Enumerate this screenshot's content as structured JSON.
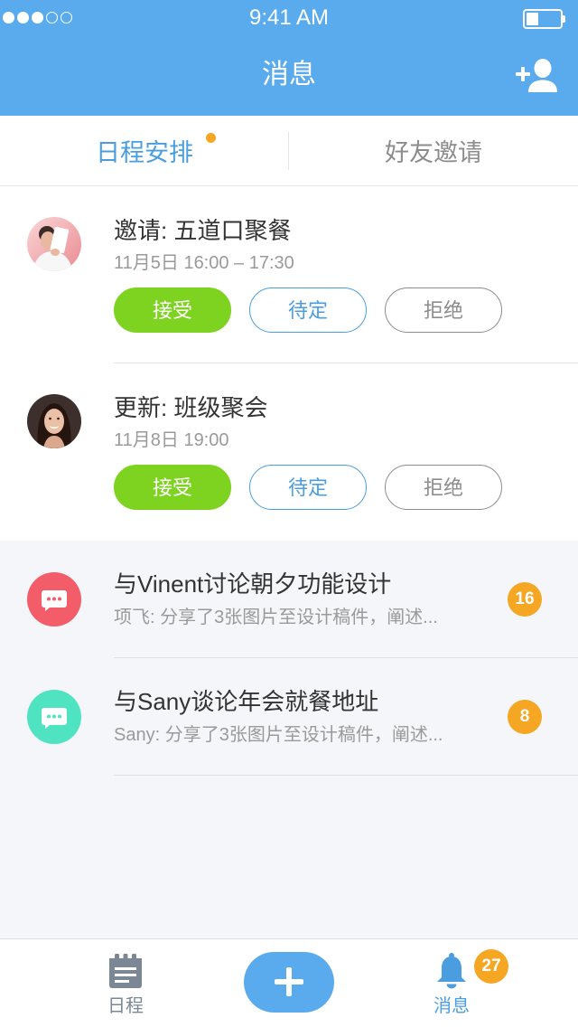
{
  "status_bar": {
    "signal_strength": 3,
    "signal_max": 5,
    "time": "9:41 AM",
    "battery_level": 0.35
  },
  "nav_bar": {
    "title": "消息",
    "action_icon": "add-user-icon"
  },
  "tabs": [
    {
      "label": "日程安排",
      "active": true,
      "unread_dot": true
    },
    {
      "label": "好友邀请",
      "active": false,
      "unread_dot": false
    }
  ],
  "invitation_actions": {
    "accept": "接受",
    "pending": "待定",
    "decline": "拒绝"
  },
  "invitations": [
    {
      "title": "邀请: 五道口聚餐",
      "time": "11月5日 16:00 – 17:30"
    },
    {
      "title": "更新: 班级聚会",
      "time": "11月8日 19:00"
    }
  ],
  "conversations": [
    {
      "title": "与Vinent讨论朝夕功能设计",
      "preview": "项飞: 分享了3张图片至设计稿件，阐述...",
      "unread": "16",
      "icon": "chat-bubble-icon",
      "icon_color": "#f35d69"
    },
    {
      "title": "与Sany谈论年会就餐地址",
      "preview": "Sany: 分享了3张图片至设计稿件，阐述...",
      "unread": "8",
      "icon": "chat-bubble-icon",
      "icon_color": "#50e3c2"
    }
  ],
  "tab_bar": {
    "schedule": {
      "label": "日程",
      "icon": "calendar-icon",
      "active": false
    },
    "compose": {
      "icon": "plus-icon"
    },
    "messages": {
      "label": "消息",
      "icon": "bell-icon",
      "active": true,
      "badge": "27"
    }
  },
  "colors": {
    "brand_blue": "#5aabed",
    "active_blue": "#4a9ee0",
    "accept_green": "#7ed321",
    "badge_orange": "#f5a623",
    "muted_gray": "#8c8c8c",
    "list_background": "#f4f6f9"
  }
}
